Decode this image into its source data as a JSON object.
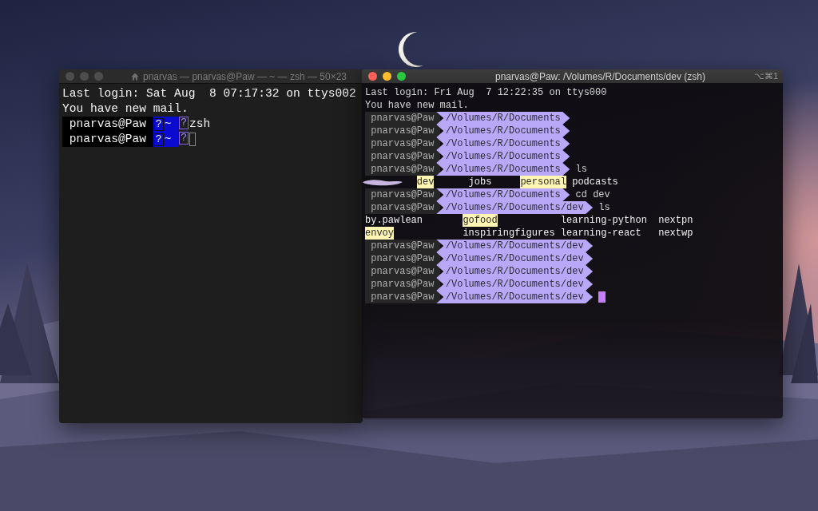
{
  "windows": [
    {
      "kind": "basic",
      "active": false,
      "title": "pnarvas — pnarvas@Paw — ~ — zsh — 50×23",
      "lines": [
        {
          "kind": "text",
          "text": "Last login: Sat Aug  8 07:17:32 on ttys002"
        },
        {
          "kind": "text",
          "text": "You have new mail."
        },
        {
          "kind": "prompt",
          "user": "pnarvas@Paw",
          "dir_icon": "?",
          "dir": "~",
          "status_icon": "?",
          "command": "zsh"
        },
        {
          "kind": "prompt",
          "user": "pnarvas@Paw",
          "dir_icon": "?",
          "dir": "~",
          "status_icon": "?",
          "cursor": true
        }
      ]
    },
    {
      "kind": "powerline",
      "active": true,
      "title": "pnarvas@Paw: /Volumes/R/Documents/dev (zsh)",
      "shortcut": "⌥⌘1",
      "lines": [
        {
          "kind": "text",
          "text": "Last login: Fri Aug  7 12:22:35 on ttys000"
        },
        {
          "kind": "text",
          "text": "You have new mail."
        },
        {
          "kind": "prompt",
          "user": "pnarvas@Paw",
          "path": "/Volumes/R/Documents"
        },
        {
          "kind": "prompt",
          "user": "pnarvas@Paw",
          "path": "/Volumes/R/Documents"
        },
        {
          "kind": "prompt",
          "user": "pnarvas@Paw",
          "path": "/Volumes/R/Documents"
        },
        {
          "kind": "prompt",
          "user": "pnarvas@Paw",
          "path": "/Volumes/R/Documents"
        },
        {
          "kind": "prompt",
          "user": "pnarvas@Paw",
          "path": "/Volumes/R/Documents",
          "command": "ls"
        },
        {
          "kind": "listing",
          "redacted": true,
          "rows": [
            [
              {
                "name": "dev",
                "highlighted": true
              },
              {
                "name": "jobs",
                "highlighted": false
              },
              {
                "name": "personal",
                "highlighted": true
              },
              {
                "name": "podcasts",
                "highlighted": false
              }
            ]
          ]
        },
        {
          "kind": "prompt",
          "user": "pnarvas@Paw",
          "path": "/Volumes/R/Documents",
          "command": "cd dev"
        },
        {
          "kind": "prompt",
          "user": "pnarvas@Paw",
          "path": "/Volumes/R/Documents/dev",
          "command": "ls"
        },
        {
          "kind": "listing",
          "rows": [
            [
              {
                "name": "by.pawlean",
                "highlighted": false
              },
              {
                "name": "gofood",
                "highlighted": true
              },
              {
                "name": "learning-python",
                "highlighted": false
              },
              {
                "name": "nextpn",
                "highlighted": false
              }
            ],
            [
              {
                "name": "envoy",
                "highlighted": true
              },
              {
                "name": "inspiringfigures",
                "highlighted": false
              },
              {
                "name": "learning-react",
                "highlighted": false
              },
              {
                "name": "nextwp",
                "highlighted": false
              }
            ]
          ]
        },
        {
          "kind": "prompt",
          "user": "pnarvas@Paw",
          "path": "/Volumes/R/Documents/dev"
        },
        {
          "kind": "prompt",
          "user": "pnarvas@Paw",
          "path": "/Volumes/R/Documents/dev"
        },
        {
          "kind": "prompt",
          "user": "pnarvas@Paw",
          "path": "/Volumes/R/Documents/dev"
        },
        {
          "kind": "prompt",
          "user": "pnarvas@Paw",
          "path": "/Volumes/R/Documents/dev"
        },
        {
          "kind": "prompt",
          "user": "pnarvas@Paw",
          "path": "/Volumes/R/Documents/dev",
          "cursor": true
        }
      ]
    }
  ]
}
